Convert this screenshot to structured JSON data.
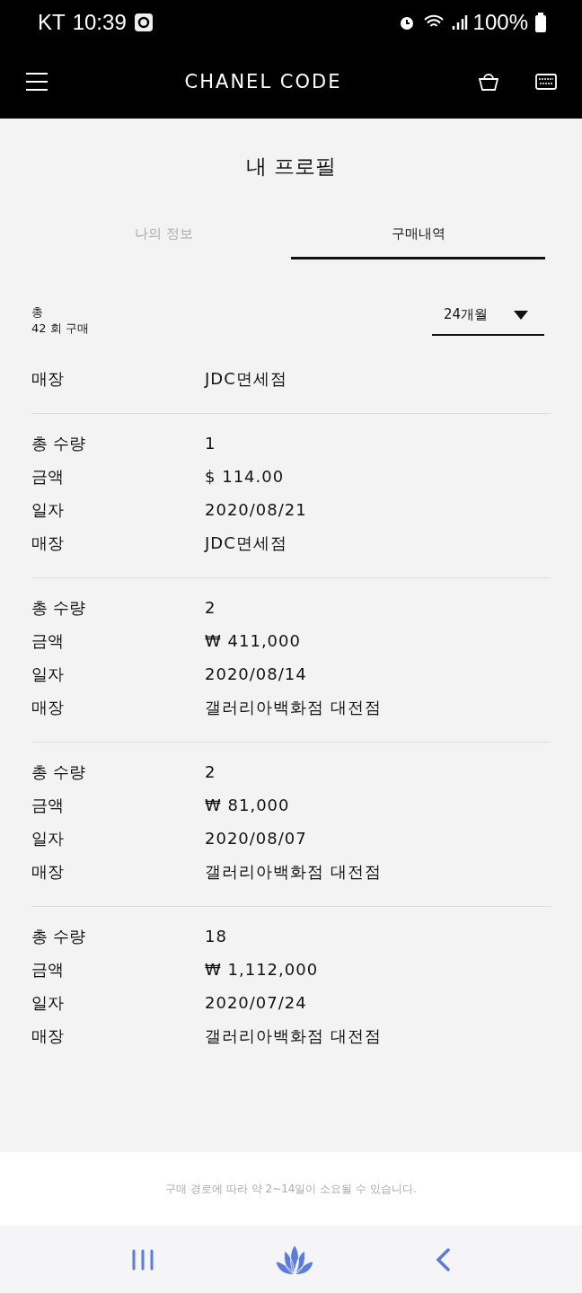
{
  "status_bar": {
    "carrier": "KT",
    "time": "10:39",
    "battery": "100%"
  },
  "header": {
    "title": "CHANEL CODE"
  },
  "page_title": "내 프로필",
  "tabs": [
    {
      "label": "나의 정보",
      "selected": false
    },
    {
      "label": "구매내역",
      "selected": true
    }
  ],
  "summary": {
    "label": "총",
    "count": "42",
    "unit": "회 구매"
  },
  "period_select": {
    "value": "24개월"
  },
  "purchases": [
    {
      "rows": [
        {
          "label": "매장",
          "value": "JDC면세점"
        }
      ]
    },
    {
      "rows": [
        {
          "label": "총 수량",
          "value": "1"
        },
        {
          "label": "금액",
          "value": "$ 114.00"
        },
        {
          "label": "일자",
          "value": "2020/08/21"
        },
        {
          "label": "매장",
          "value": "JDC면세점"
        }
      ]
    },
    {
      "rows": [
        {
          "label": "총 수량",
          "value": "2"
        },
        {
          "label": "금액",
          "value": "₩ 411,000"
        },
        {
          "label": "일자",
          "value": "2020/08/14"
        },
        {
          "label": "매장",
          "value": "갤러리아백화점 대전점"
        }
      ]
    },
    {
      "rows": [
        {
          "label": "총 수량",
          "value": "2"
        },
        {
          "label": "금액",
          "value": "₩ 81,000"
        },
        {
          "label": "일자",
          "value": "2020/08/07"
        },
        {
          "label": "매장",
          "value": "갤러리아백화점 대전점"
        }
      ]
    },
    {
      "rows": [
        {
          "label": "총 수량",
          "value": "18"
        },
        {
          "label": "금액",
          "value": "₩ 1,112,000"
        },
        {
          "label": "일자",
          "value": "2020/07/24"
        },
        {
          "label": "매장",
          "value": "갤러리아백화점 대전점"
        }
      ]
    }
  ],
  "footer_note": "구매 경로에 따라 약 2~14일이 소요될 수 있습니다."
}
